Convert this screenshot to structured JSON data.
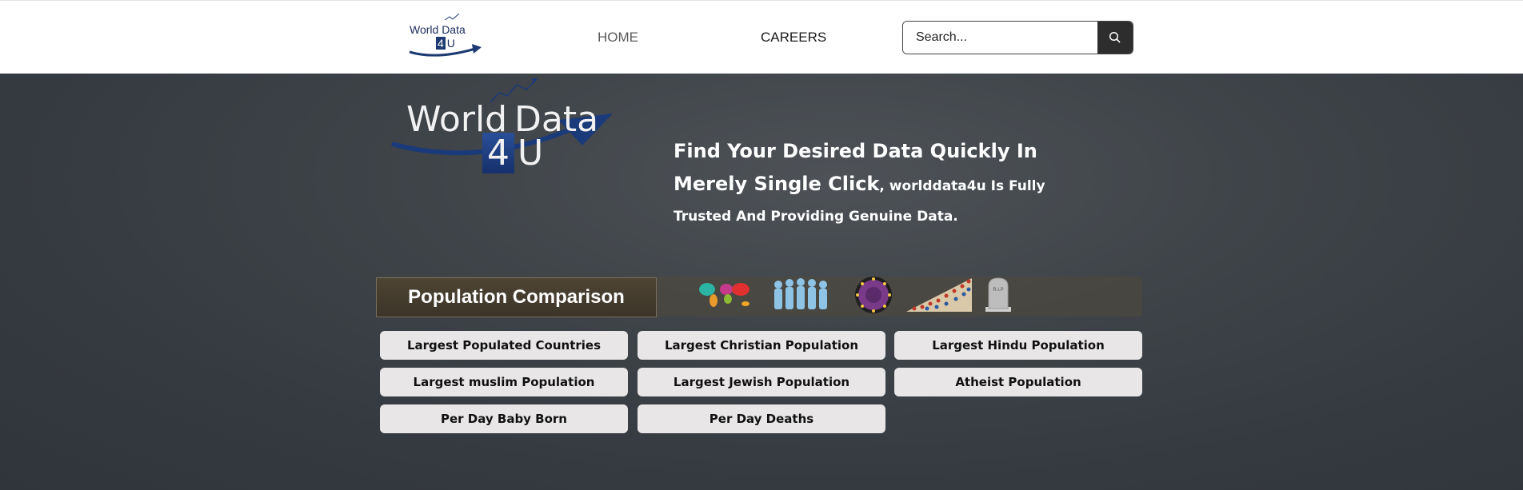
{
  "header": {
    "logo": {
      "line1": "World  Data",
      "four": "4",
      "u": "U"
    },
    "nav": {
      "home": "HOME",
      "careers": "CAREERS"
    },
    "search": {
      "placeholder": "Search..."
    }
  },
  "hero": {
    "logo": {
      "word1": "World",
      "word2": "Data",
      "four": "4",
      "u": "U"
    },
    "tagline_main": "Find Your Desired Data Quickly In Merely Single Click",
    "tagline_rest": ", worlddata4u Is Fully Trusted And Providing Genuine Data."
  },
  "population": {
    "title": "Population Comparison",
    "icons": [
      "world-map-icon",
      "people-crowd-icon",
      "religion-symbols-icon",
      "population-growth-icon",
      "tombstone-icon"
    ],
    "tombstone_text": "R.I.P"
  },
  "links": [
    "Largest Populated Countries",
    "Largest Christian Population",
    "Largest Hindu Population",
    "Largest muslim Population",
    "Largest Jewish Population",
    "Atheist Population",
    "Per Day Baby Born",
    "Per Day Deaths"
  ],
  "colors": {
    "brand_navy": "#1b2d5a",
    "search_button": "#2d2d2d",
    "link_button_bg": "#e8e6e6"
  }
}
